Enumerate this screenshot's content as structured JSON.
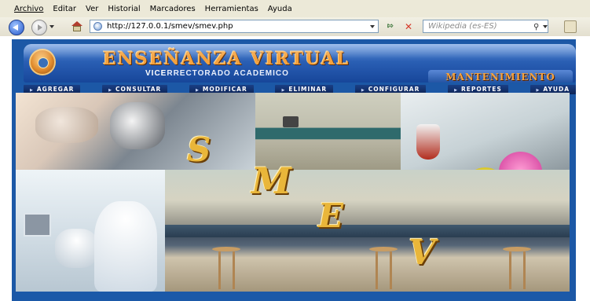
{
  "browser": {
    "menu": [
      "Archivo",
      "Editar",
      "Ver",
      "Historial",
      "Marcadores",
      "Herramientas",
      "Ayuda"
    ],
    "url": "http://127.0.0.1/smev/smev.php",
    "search_placeholder": "Wikipedia (es-ES)"
  },
  "header": {
    "title": "ENSEÑANZA VIRTUAL",
    "subtitle_prefix": "VICE",
    "subtitle_rest": "RRECTORADO ACADEMICO",
    "section": "MANTENIMIENTO"
  },
  "nav": {
    "items": [
      "AGREGAR",
      "CONSULTAR",
      "MODIFICAR",
      "ELIMINAR",
      "CONFIGURAR",
      "REPORTES",
      "AYUDA"
    ]
  },
  "collage": {
    "letters": [
      "S",
      "M",
      "E",
      "V"
    ]
  },
  "colors": {
    "frame": "#1c58a6",
    "title": "#f4a23e",
    "nav": "#0d2456"
  }
}
